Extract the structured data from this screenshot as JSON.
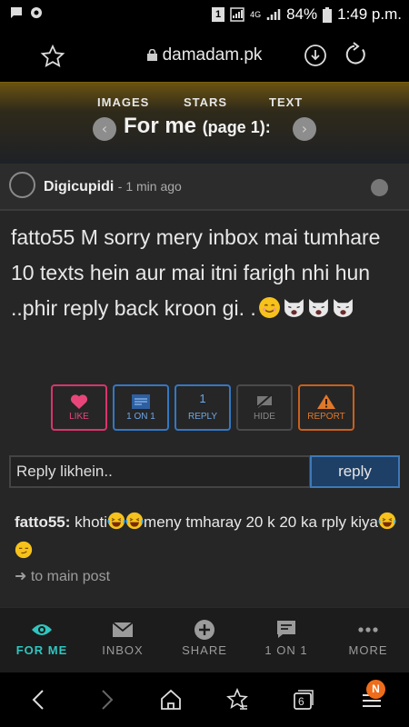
{
  "status_bar": {
    "battery": "84%",
    "time": "1:49 p.m.",
    "sim": "1",
    "network": "4G"
  },
  "browser": {
    "url": "damadam.pk",
    "tabs_count": "6",
    "menu_badge": "N"
  },
  "site_nav": {
    "items": [
      "IMAGES",
      "STARS",
      "TEXT"
    ]
  },
  "page": {
    "title": "For me",
    "page_label": "(page 1):"
  },
  "post": {
    "username": "Digicupidi",
    "time": "- 1 min ago",
    "text": "fatto55 M sorry mery inbox mai tumhare 10 texts hein aur mai itni farigh nhi hun ..phir reply back kroon gi. .",
    "actions": {
      "like": "LIKE",
      "one_on_one": "1 ON 1",
      "reply": "REPLY",
      "reply_count": "1",
      "hide": "HIDE",
      "report": "REPORT"
    }
  },
  "reply_box": {
    "placeholder": "Reply likhein..",
    "button": "reply"
  },
  "comment": {
    "author": "fatto55:",
    "text_part1": " khoti",
    "text_part2": "meny tmharay 20 k 20 ka rply kiya"
  },
  "to_main": "➜ to main post",
  "bottom_nav": {
    "for_me": "FOR ME",
    "inbox": "INBOX",
    "share": "SHARE",
    "one_on_one": "1 ON 1",
    "more": "MORE"
  },
  "colors": {
    "accent": "#2fc6bf",
    "like": "#e8467a",
    "blue": "#3477c4",
    "report": "#e0782a"
  }
}
